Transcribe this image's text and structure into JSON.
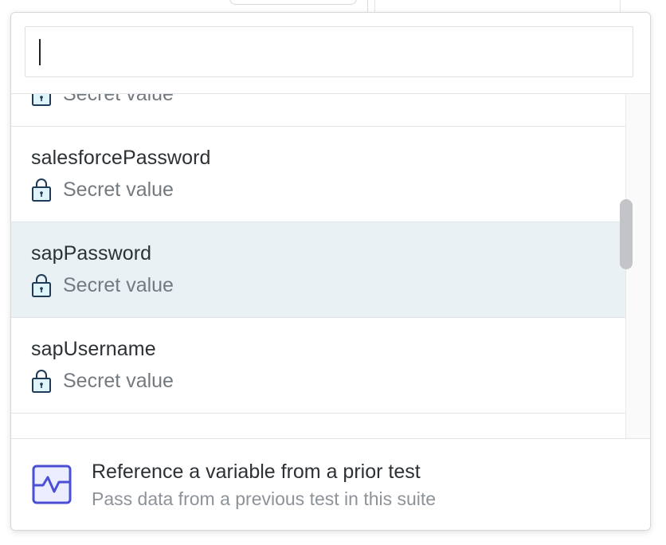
{
  "search": {
    "value": "",
    "placeholder": ""
  },
  "variables": [
    {
      "name": "",
      "type_label": "Secret value",
      "icon": "lock-icon",
      "selected": false
    },
    {
      "name": "salesforcePassword",
      "type_label": "Secret value",
      "icon": "lock-icon",
      "selected": false
    },
    {
      "name": "sapPassword",
      "type_label": "Secret value",
      "icon": "lock-icon",
      "selected": true
    },
    {
      "name": "sapUsername",
      "type_label": "Secret value",
      "icon": "lock-icon",
      "selected": false
    }
  ],
  "footer": {
    "title": "Reference a variable from a prior test",
    "subtitle": "Pass data from a previous test in this suite",
    "icon": "activity-chart-icon"
  },
  "colors": {
    "selected_row": "#e9f1f4",
    "lock_icon_fill": "#dff3fb",
    "icon_stroke": "#1f3b57",
    "footer_icon_accent": "#4a4fd3"
  }
}
